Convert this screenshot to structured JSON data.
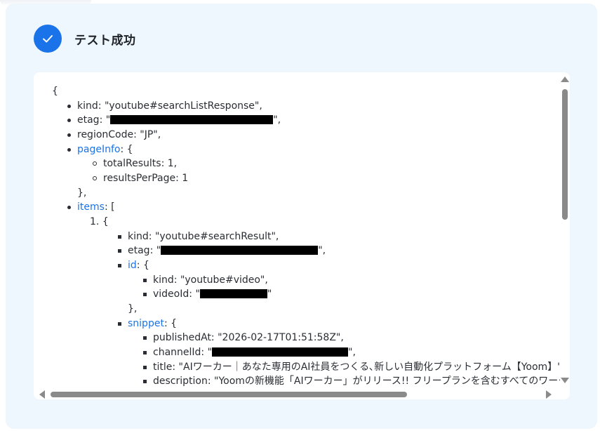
{
  "header": {
    "title": "テスト成功",
    "check_icon": "check-icon",
    "accent_color": "#1a73e8"
  },
  "json_view": {
    "open_brace": "{",
    "kind_key": "kind",
    "kind_value": "\"youtube#searchListResponse\",",
    "etag_key": "etag",
    "etag_prefix": "\"",
    "etag_suffix": "\",",
    "region_key": "regionCode",
    "region_value": "\"JP\",",
    "pageinfo_key": "pageInfo",
    "pageinfo_open": ": {",
    "total_results_key": "totalResults",
    "total_results_value": "1,",
    "results_per_page_key": "resultsPerPage",
    "results_per_page_value": "1",
    "close_obj_comma": "},",
    "items_key": "items",
    "items_open": ": [",
    "item_index": "1.",
    "item_open": "{",
    "item_kind_key": "kind",
    "item_kind_value": "\"youtube#searchResult\",",
    "item_etag_key": "etag",
    "item_etag_prefix": "\"",
    "item_etag_suffix": "\",",
    "id_key": "id",
    "id_open": ": {",
    "id_kind_key": "kind",
    "id_kind_value": "\"youtube#video\",",
    "video_id_key": "videoId",
    "video_id_prefix": "\"",
    "video_id_suffix": "\"",
    "id_close": "},",
    "snippet_key": "snippet",
    "snippet_open": ": {",
    "published_key": "publishedAt",
    "published_value": "\"2026-02-17T01:51:58Z\",",
    "channel_id_key": "channelId",
    "channel_id_prefix": "\"",
    "channel_id_suffix": "\",",
    "title_key": "title",
    "title_value": "\"AIワーカー｜あなた専用のAI社員をつくる､新しい自動化プラットフォーム【Yoom】\",",
    "description_key": "description",
    "description_value": "\"Yoomの新機能「AIワーカー」がリリース!! フリープランを含むすべてのワークス"
  }
}
